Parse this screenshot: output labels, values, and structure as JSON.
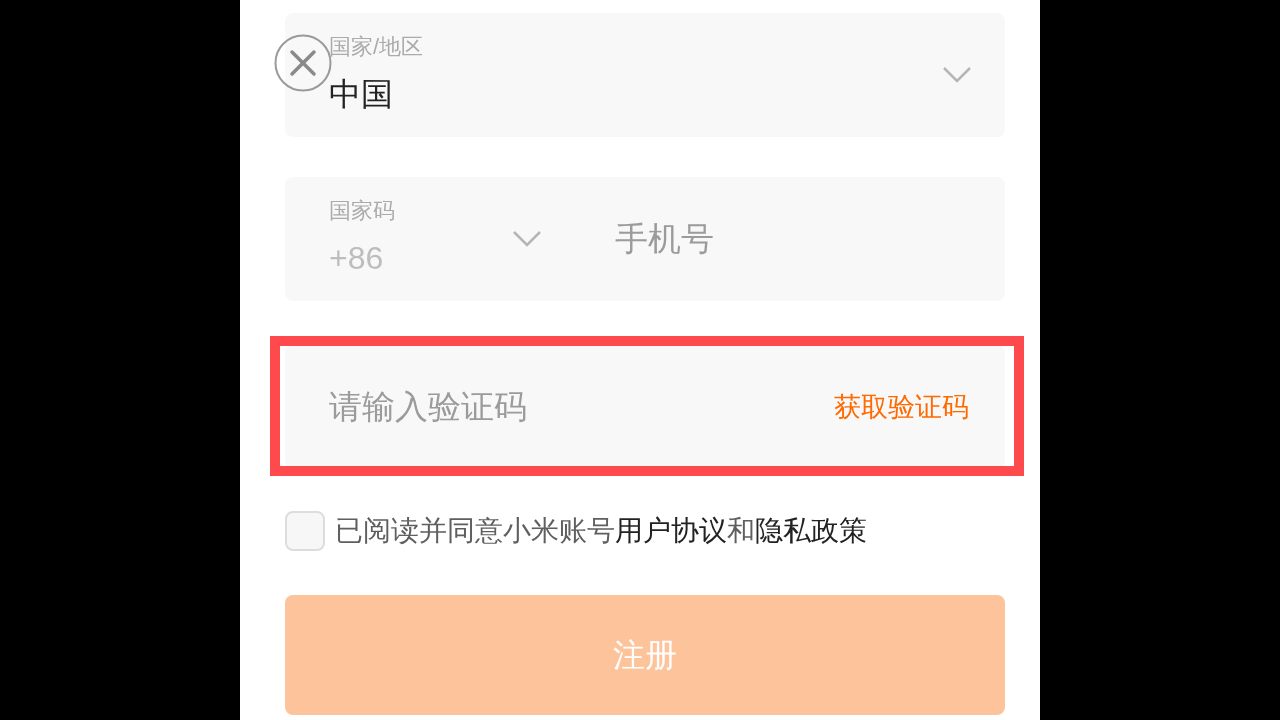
{
  "region_field": {
    "label": "国家/地区",
    "value": "中国"
  },
  "phone_field": {
    "code_label": "国家码",
    "code_value": "+86",
    "placeholder": "手机号"
  },
  "code_field": {
    "placeholder": "请输入验证码",
    "action": "获取验证码",
    "highlighted": true
  },
  "agreement": {
    "checked": false,
    "parts": [
      {
        "text": "已阅读并同意小米账号",
        "kind": "plain"
      },
      {
        "text": "用户协议",
        "kind": "link"
      },
      {
        "text": "和",
        "kind": "plain"
      },
      {
        "text": "隐私政策",
        "kind": "link"
      }
    ]
  },
  "submit_button": {
    "label": "注册",
    "disabled": true
  }
}
